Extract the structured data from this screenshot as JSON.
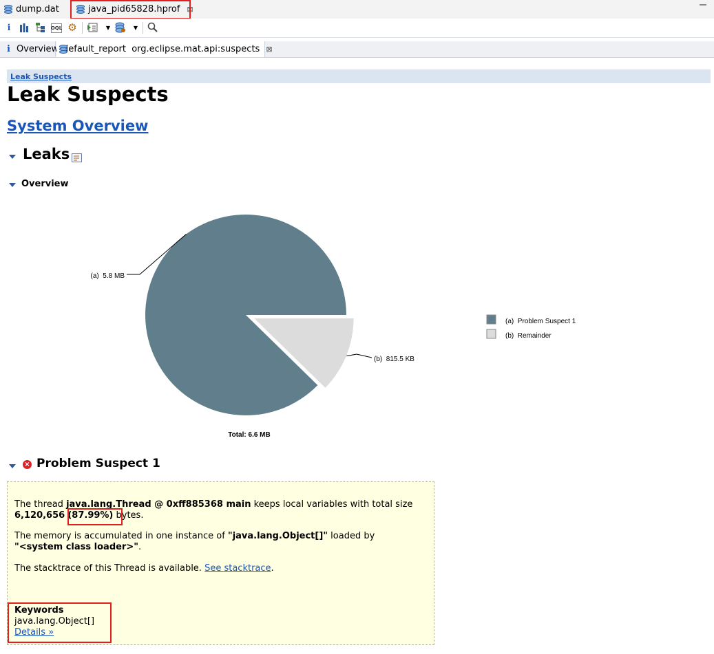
{
  "editor_tabs": [
    {
      "label": "dump.dat"
    },
    {
      "label": "java_pid65828.hprof"
    }
  ],
  "sub_tabs": [
    {
      "label": "Overview"
    },
    {
      "label": "default_report  org.eclipse.mat.api:suspects"
    }
  ],
  "report": {
    "breadcrumb": "Leak Suspects",
    "title": "Leak Suspects",
    "system_overview_link": "System Overview",
    "leaks_heading": "Leaks",
    "overview_heading": "Overview",
    "problem_suspect_heading": "Problem Suspect 1",
    "suspect": {
      "p1_pre": "The thread ",
      "p1_thread": "java.lang.Thread @ 0xff885368 main",
      "p1_mid": " keeps local variables with total size",
      "p1_size": "6,120,656",
      "p1_percent": "(87.99%)",
      "p1_end": " bytes.",
      "p2_pre": "The memory is accumulated in one instance of ",
      "p2_class": "\"java.lang.Object[]\"",
      "p2_mid": " loaded by",
      "p2_loader": "\"<system class loader>\"",
      "p2_end": ".",
      "p3_pre": "The stacktrace of this Thread is available. ",
      "p3_link": "See stacktrace",
      "p3_end": ".",
      "keywords_label": "Keywords",
      "keyword": "java.lang.Object[]",
      "details_link": "Details »"
    }
  },
  "chart_data": {
    "type": "pie",
    "slices": [
      {
        "label": "(a)  5.8 MB",
        "legend": "(a)  Problem Suspect 1",
        "value": 5.8,
        "color": "#617e8c"
      },
      {
        "label": "(b)  815.5 KB",
        "legend": "(b)  Remainder",
        "value": 0.8155,
        "color": "#dcdcdc"
      }
    ],
    "total_label": "Total: 6.6 MB"
  }
}
